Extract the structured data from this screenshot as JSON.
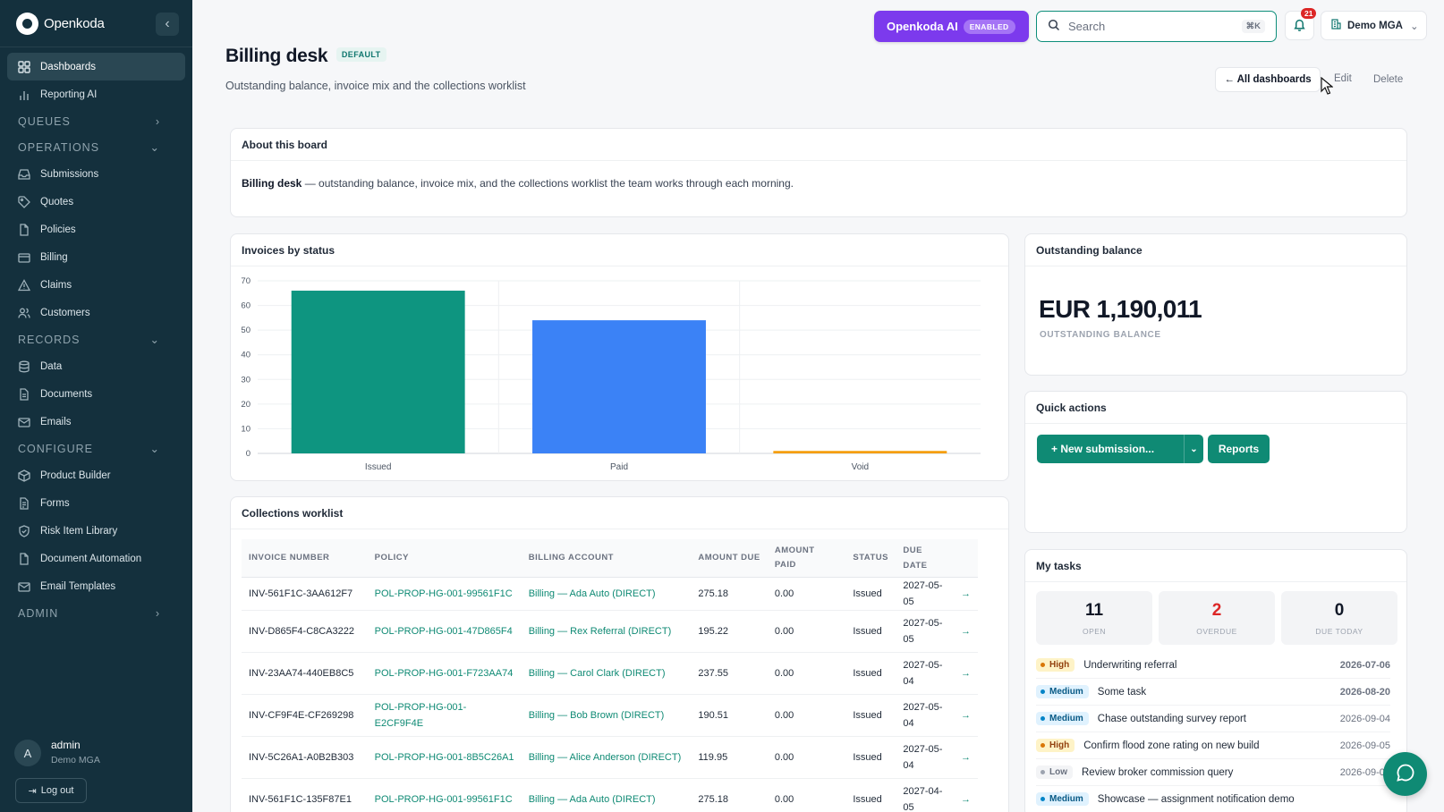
{
  "brand": {
    "name": "Openkoda",
    "collapse_icon": "‹"
  },
  "nav": {
    "dashboards": "Dashboards",
    "reporting_ai": "Reporting AI",
    "queues": "QUEUES",
    "operations": "OPERATIONS",
    "submissions": "Submissions",
    "quotes": "Quotes",
    "policies": "Policies",
    "billing": "Billing",
    "claims": "Claims",
    "customers": "Customers",
    "records": "RECORDS",
    "data": "Data",
    "documents": "Documents",
    "emails": "Emails",
    "configure": "CONFIGURE",
    "product_builder": "Product Builder",
    "forms": "Forms",
    "risk_item_library": "Risk Item Library",
    "document_automation": "Document Automation",
    "email_templates": "Email Templates",
    "admin": "ADMIN"
  },
  "user": {
    "initial": "A",
    "name": "admin",
    "org": "Demo MGA",
    "logout": "Log out"
  },
  "topbar": {
    "ai_label": "Openkoda AI",
    "ai_badge": "ENABLED",
    "search_placeholder": "Search",
    "search_kbd": "⌘K",
    "notification_count": "21",
    "org_name": "Demo MGA"
  },
  "header": {
    "title": "Billing desk",
    "badge": "DEFAULT",
    "subtitle": "Outstanding balance, invoice mix and the collections worklist",
    "all_dashboards": "← All dashboards",
    "edit": "Edit",
    "delete": "Delete"
  },
  "about": {
    "title": "About this board",
    "bold": "Billing desk",
    "text": " — outstanding balance, invoice mix, and the collections worklist the team works through each morning."
  },
  "invoices_card": {
    "title": "Invoices by status"
  },
  "chart_data": {
    "type": "bar",
    "title": "Invoices by status",
    "categories": [
      "Issued",
      "Paid",
      "Void"
    ],
    "values": [
      66,
      54,
      1
    ],
    "colors": [
      "#0e9580",
      "#3b82f6",
      "#f59e0b"
    ],
    "ylim": [
      0,
      70
    ],
    "yticks": [
      0,
      10,
      20,
      30,
      40,
      50,
      60,
      70
    ],
    "grid": true
  },
  "balance": {
    "title": "Outstanding balance",
    "value": "EUR 1,190,011",
    "label": "OUTSTANDING BALANCE"
  },
  "quick_actions": {
    "title": "Quick actions",
    "new_submission": "+ New submission...",
    "reports": "Reports"
  },
  "worklist": {
    "title": "Collections worklist",
    "columns": [
      "INVOICE NUMBER",
      "POLICY",
      "BILLING ACCOUNT",
      "AMOUNT DUE",
      "AMOUNT PAID",
      "STATUS",
      "DUE DATE",
      ""
    ],
    "rows": [
      [
        "INV-561F1C-3AA612F7",
        "POL-PROP-HG-001-99561F1C",
        "Billing — Ada Auto (DIRECT)",
        "275.18",
        "0.00",
        "Issued",
        "2027-05-05",
        "→"
      ],
      [
        "INV-D865F4-C8CA3222",
        "POL-PROP-HG-001-47D865F4",
        "Billing — Rex Referral (DIRECT)",
        "195.22",
        "0.00",
        "Issued",
        "2027-05-05",
        "→"
      ],
      [
        "INV-23AA74-440EB8C5",
        "POL-PROP-HG-001-F723AA74",
        "Billing — Carol Clark (DIRECT)",
        "237.55",
        "0.00",
        "Issued",
        "2027-05-04",
        "→"
      ],
      [
        "INV-CF9F4E-CF269298",
        "POL-PROP-HG-001-E2CF9F4E",
        "Billing — Bob Brown (DIRECT)",
        "190.51",
        "0.00",
        "Issued",
        "2027-05-04",
        "→"
      ],
      [
        "INV-5C26A1-A0B2B303",
        "POL-PROP-HG-001-8B5C26A1",
        "Billing — Alice Anderson (DIRECT)",
        "119.95",
        "0.00",
        "Issued",
        "2027-05-04",
        "→"
      ],
      [
        "INV-561F1C-135F87E1",
        "POL-PROP-HG-001-99561F1C",
        "Billing — Ada Auto (DIRECT)",
        "275.18",
        "0.00",
        "Issued",
        "2027-04-05",
        "→"
      ]
    ]
  },
  "tasks": {
    "title": "My tasks",
    "stats": [
      {
        "value": "11",
        "label": "OPEN",
        "color": "#111827"
      },
      {
        "value": "2",
        "label": "OVERDUE",
        "color": "#dc2626"
      },
      {
        "value": "0",
        "label": "DUE TODAY",
        "color": "#111827"
      }
    ],
    "items": [
      {
        "priority": "High",
        "level": "high",
        "title": "Underwriting referral",
        "date": "2026-07-06",
        "overdue": true
      },
      {
        "priority": "Medium",
        "level": "medium",
        "title": "Some task",
        "date": "2026-08-20",
        "overdue": true
      },
      {
        "priority": "Medium",
        "level": "medium",
        "title": "Chase outstanding survey report",
        "date": "2026-09-04",
        "overdue": false
      },
      {
        "priority": "High",
        "level": "high",
        "title": "Confirm flood zone rating on new build",
        "date": "2026-09-05",
        "overdue": false
      },
      {
        "priority": "Low",
        "level": "low",
        "title": "Review broker commission query",
        "date": "2026-09-06",
        "overdue": false
      },
      {
        "priority": "Medium",
        "level": "medium",
        "title": "Showcase — assignment notification demo",
        "date": "",
        "overdue": false
      }
    ]
  }
}
